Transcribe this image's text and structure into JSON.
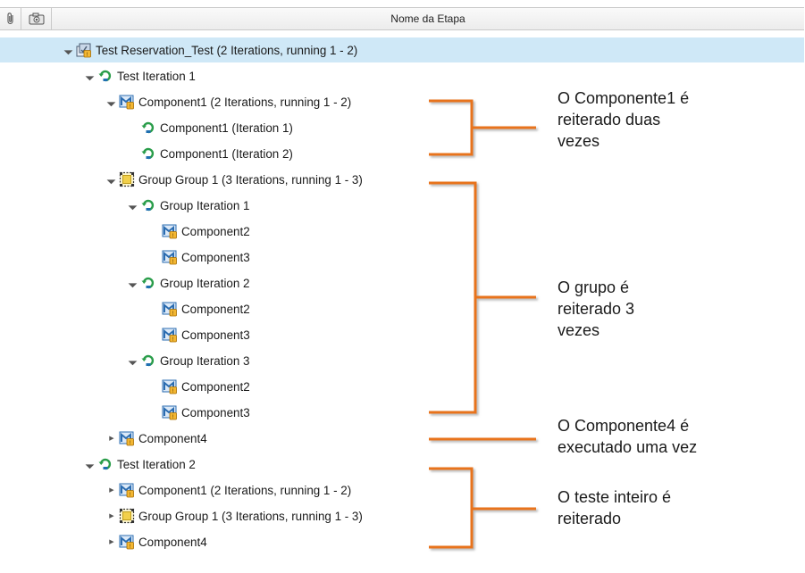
{
  "header": {
    "column_name": "Nome da Etapa",
    "attach_icon": "paperclip-icon",
    "snapshot_icon": "camera-icon"
  },
  "tree": [
    {
      "label": "Test Reservation_Test (2 Iterations, running 1 - 2)",
      "icon": "test-icon",
      "caret": "open",
      "depth": 0,
      "selected": true
    },
    {
      "label": "Test Iteration 1",
      "icon": "iteration-icon",
      "caret": "open",
      "depth": 1
    },
    {
      "label": "Component1 (2 Iterations, running 1 - 2)",
      "icon": "component-icon",
      "caret": "open",
      "depth": 2
    },
    {
      "label": "Component1 (Iteration 1)",
      "icon": "iteration-icon",
      "caret": "none",
      "depth": 3
    },
    {
      "label": "Component1 (Iteration 2)",
      "icon": "iteration-icon",
      "caret": "none",
      "depth": 3
    },
    {
      "label": "Group Group 1 (3 Iterations, running 1 - 3)",
      "icon": "group-icon",
      "caret": "open",
      "depth": 2
    },
    {
      "label": "Group Iteration 1",
      "icon": "iteration-icon",
      "caret": "open",
      "depth": 3
    },
    {
      "label": "Component2",
      "icon": "component-icon",
      "caret": "none",
      "depth": 4
    },
    {
      "label": "Component3",
      "icon": "component-icon",
      "caret": "none",
      "depth": 4
    },
    {
      "label": "Group Iteration 2",
      "icon": "iteration-icon",
      "caret": "open",
      "depth": 3
    },
    {
      "label": "Component2",
      "icon": "component-icon",
      "caret": "none",
      "depth": 4
    },
    {
      "label": "Component3",
      "icon": "component-icon",
      "caret": "none",
      "depth": 4
    },
    {
      "label": "Group Iteration 3",
      "icon": "iteration-icon",
      "caret": "open",
      "depth": 3
    },
    {
      "label": "Component2",
      "icon": "component-icon",
      "caret": "none",
      "depth": 4
    },
    {
      "label": "Component3",
      "icon": "component-icon",
      "caret": "none",
      "depth": 4
    },
    {
      "label": "Component4",
      "icon": "component-icon",
      "caret": "closed",
      "depth": 2
    },
    {
      "label": "Test Iteration 2",
      "icon": "iteration-icon",
      "caret": "open",
      "depth": 1
    },
    {
      "label": "Component1 (2 Iterations, running 1 - 2)",
      "icon": "component-icon",
      "caret": "closed",
      "depth": 2
    },
    {
      "label": "Group Group 1 (3 Iterations, running 1 - 3)",
      "icon": "group-icon",
      "caret": "closed",
      "depth": 2
    },
    {
      "label": "Component4",
      "icon": "component-icon",
      "caret": "closed",
      "depth": 2
    }
  ],
  "annotations": [
    {
      "text": "O Componente1 é\nreiterado duas\nvezes"
    },
    {
      "text": "O grupo é\nreiterado 3\nvezes"
    },
    {
      "text": "O Componente4 é\nexecutado uma vez"
    },
    {
      "text": "O teste inteiro é\nreiterado"
    }
  ],
  "colors": {
    "bracket": "#e8731a",
    "selected_row": "#cfe8f7",
    "iteration_icon": "#2a9d4a",
    "component_icon": "#2b6cb0"
  }
}
